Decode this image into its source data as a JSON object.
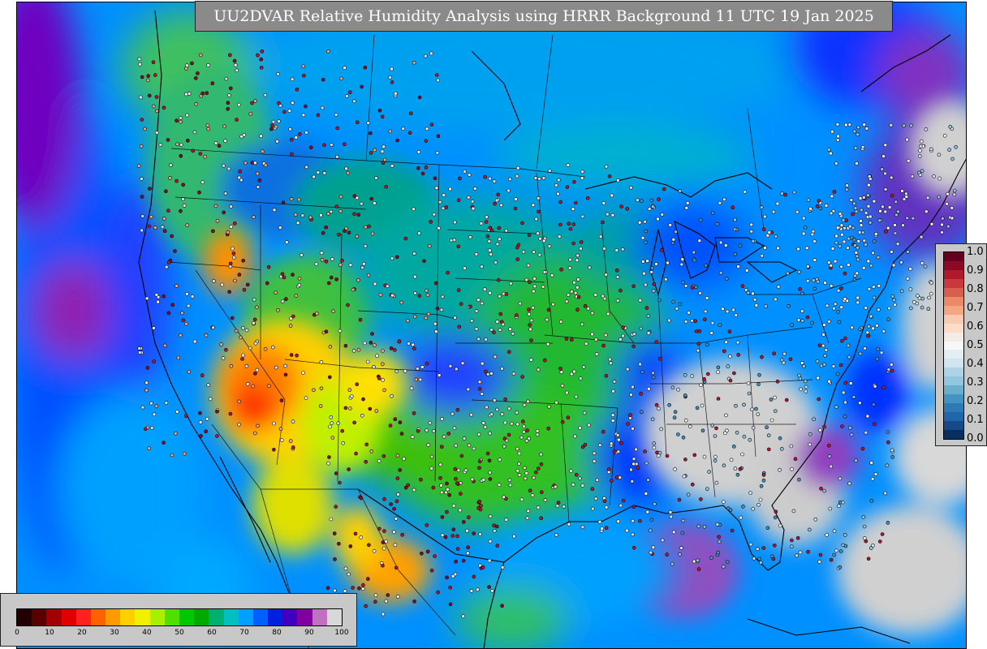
{
  "title": "UU2DVAR Relative Humidity Analysis using HRRR Background 11 UTC 19 Jan 2025",
  "rh_colorbar": {
    "ticks": [
      "0",
      "10",
      "20",
      "30",
      "40",
      "50",
      "60",
      "70",
      "80",
      "90",
      "100"
    ],
    "colors": [
      "#200000",
      "#5a0000",
      "#a00000",
      "#e00000",
      "#ff2020",
      "#ff6000",
      "#ff9a00",
      "#ffd000",
      "#f0f000",
      "#a8f000",
      "#50e000",
      "#00c800",
      "#00a800",
      "#00b070",
      "#00c0c0",
      "#00a0ff",
      "#0060ff",
      "#0020e0",
      "#4000c0",
      "#8000a0",
      "#c070c0",
      "#d8d8d8"
    ]
  },
  "station_colorbar": {
    "ticks": [
      "1.0",
      "0.9",
      "0.8",
      "0.7",
      "0.6",
      "0.5",
      "0.4",
      "0.3",
      "0.2",
      "0.1",
      "0.0"
    ],
    "colors": [
      "#67001f",
      "#8b0a25",
      "#b2182b",
      "#c9383a",
      "#d6604d",
      "#ec8a67",
      "#f4a582",
      "#f9c9b0",
      "#fddbc7",
      "#f5ebe6",
      "#f7f7f7",
      "#e3edf2",
      "#d1e5f0",
      "#aed3e6",
      "#92c5de",
      "#6aaecd",
      "#4393c3",
      "#3179b4",
      "#2166ac",
      "#16498a",
      "#053061"
    ]
  }
}
